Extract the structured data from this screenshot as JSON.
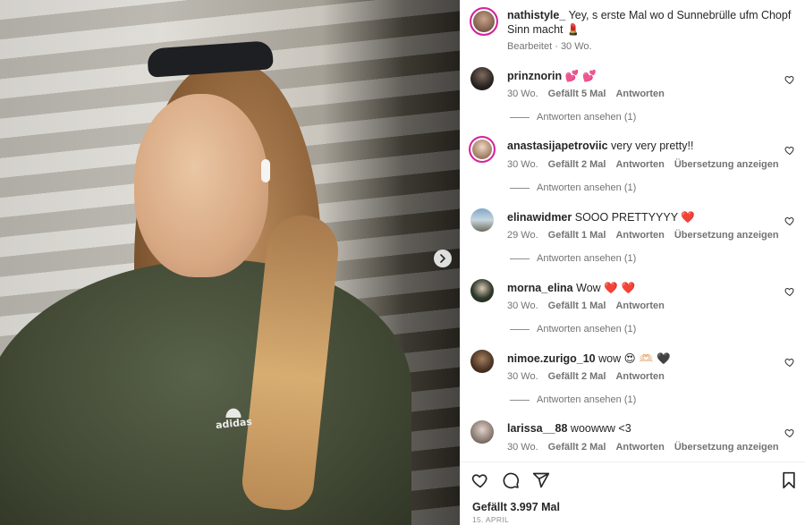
{
  "post": {
    "author": "nathistyle_",
    "caption": "Yey, s erste Mal wo d Sunnebrülle ufm Chopf Sinn macht",
    "caption_emoji": "💄",
    "edited": "Bearbeitet",
    "separator": " · ",
    "age": "30 Wo.",
    "image": {
      "print_text": "adidas",
      "next_icon": "chevron-right-icon"
    }
  },
  "comments": [
    {
      "user": "prinznorin",
      "text": "",
      "emoji": "💕 💕",
      "age": "30 Wo.",
      "likes": "Gefällt 5 Mal",
      "reply": "Antworten",
      "translate": "",
      "replies": "Antworten ansehen (1)"
    },
    {
      "user": "anastasijapetroviic",
      "text": "very very pretty!!",
      "emoji": "",
      "age": "30 Wo.",
      "likes": "Gefällt 2 Mal",
      "reply": "Antworten",
      "translate": "Übersetzung anzeigen",
      "replies": "Antworten ansehen (1)"
    },
    {
      "user": "elinawidmer",
      "text": "SOOO PRETTYYYY",
      "emoji": "❤️",
      "age": "29 Wo.",
      "likes": "Gefällt 1 Mal",
      "reply": "Antworten",
      "translate": "Übersetzung anzeigen",
      "replies": "Antworten ansehen (1)"
    },
    {
      "user": "morna_elina",
      "text": "Wow",
      "emoji": "❤️ ❤️",
      "age": "30 Wo.",
      "likes": "Gefällt 1 Mal",
      "reply": "Antworten",
      "translate": "",
      "replies": "Antworten ansehen (1)"
    },
    {
      "user": "nimoe.zurigo_10",
      "text": "wow",
      "emoji": "😍 🫶🏻 🖤",
      "age": "30 Wo.",
      "likes": "Gefällt 2 Mal",
      "reply": "Antworten",
      "translate": "",
      "replies": "Antworten ansehen (1)"
    },
    {
      "user": "larissa__88",
      "text": "woowww <3",
      "emoji": "",
      "age": "30 Wo.",
      "likes": "Gefällt 2 Mal",
      "reply": "Antworten",
      "translate": "Übersetzung anzeigen",
      "replies": ""
    }
  ],
  "footer": {
    "likes": "Gefällt 3.997 Mal",
    "date": "15. APRIL",
    "icons": [
      "heart-icon",
      "comment-icon",
      "share-icon",
      "bookmark-icon"
    ]
  },
  "colors": {
    "accent_heart": "#e0245e",
    "story_ring": "#d6249f",
    "muted_text": "#737373"
  }
}
